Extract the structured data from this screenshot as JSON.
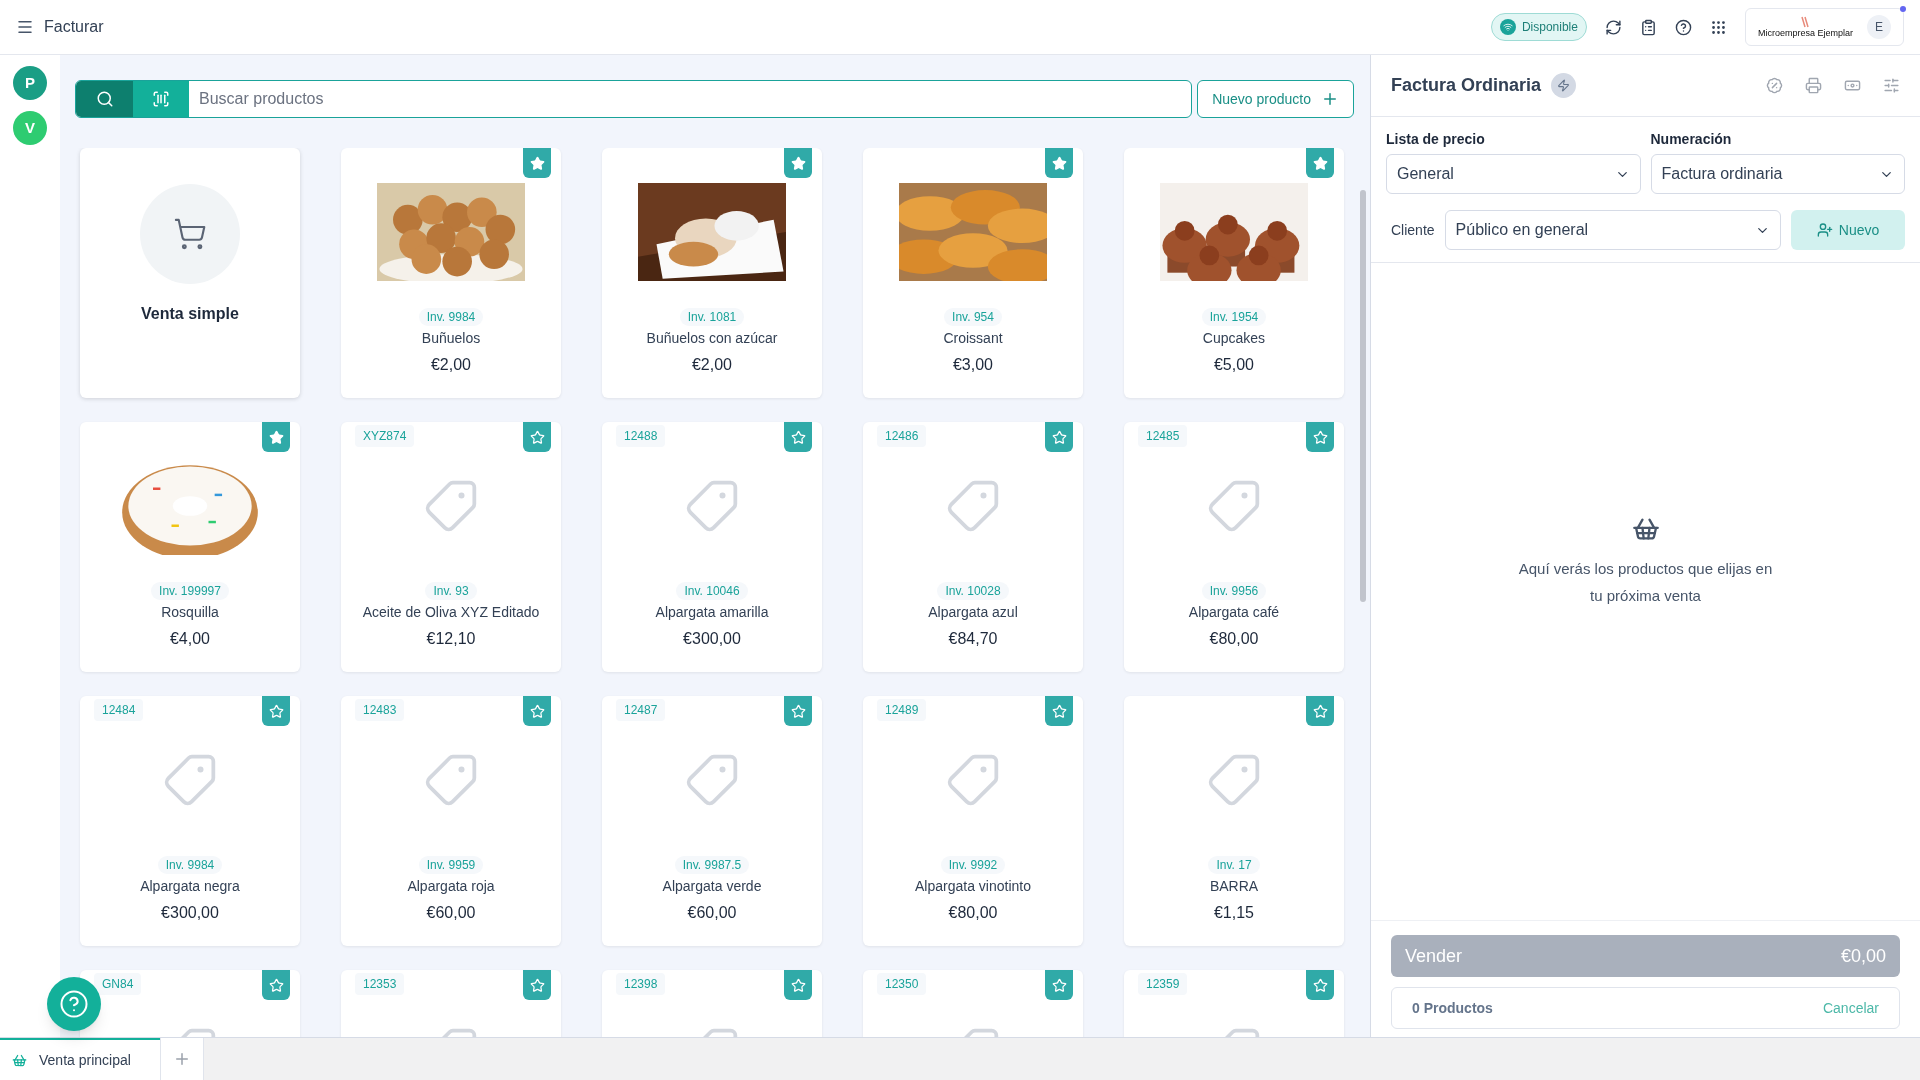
{
  "topbar": {
    "title": "Facturar",
    "status": "Disponible",
    "company": "Microempresa Ejemplar",
    "avatar": "E"
  },
  "sidebar": {
    "avatars": [
      {
        "letter": "P",
        "color": "#1a9e85"
      },
      {
        "letter": "V",
        "color": "#2ecc71"
      }
    ]
  },
  "search": {
    "placeholder": "Buscar productos",
    "new_button": "Nuevo producto"
  },
  "products": [
    {
      "kind": "simple",
      "name": "Venta simple"
    },
    {
      "kind": "product",
      "photo": true,
      "inv": "Inv. 9984",
      "name": "Buñuelos",
      "price": "€2,00",
      "favorite": true
    },
    {
      "kind": "product",
      "photo": true,
      "inv": "Inv. 1081",
      "name": "Buñuelos con azúcar",
      "price": "€2,00",
      "favorite": true
    },
    {
      "kind": "product",
      "photo": true,
      "inv": "Inv. 954",
      "name": "Croissant",
      "price": "€3,00",
      "favorite": true
    },
    {
      "kind": "product",
      "photo": true,
      "inv": "Inv. 1954",
      "name": "Cupcakes",
      "price": "€5,00",
      "favorite": true
    },
    {
      "kind": "product",
      "photo": true,
      "inv": "Inv. 199997",
      "name": "Rosquilla",
      "price": "€4,00",
      "favorite": true
    },
    {
      "kind": "product",
      "code": "XYZ874",
      "inv": "Inv. 93",
      "name": "Aceite de Oliva XYZ Editado",
      "price": "€12,10",
      "favorite": false
    },
    {
      "kind": "product",
      "code": "12488",
      "inv": "Inv. 10046",
      "name": "Alpargata amarilla",
      "price": "€300,00",
      "favorite": false
    },
    {
      "kind": "product",
      "code": "12486",
      "inv": "Inv. 10028",
      "name": "Alpargata azul",
      "price": "€84,70",
      "favorite": false
    },
    {
      "kind": "product",
      "code": "12485",
      "inv": "Inv. 9956",
      "name": "Alpargata café",
      "price": "€80,00",
      "favorite": false
    },
    {
      "kind": "product",
      "code": "12484",
      "inv": "Inv. 9984",
      "name": "Alpargata negra",
      "price": "€300,00",
      "favorite": false
    },
    {
      "kind": "product",
      "code": "12483",
      "inv": "Inv. 9959",
      "name": "Alpargata roja",
      "price": "€60,00",
      "favorite": false
    },
    {
      "kind": "product",
      "code": "12487",
      "inv": "Inv. 9987.5",
      "name": "Alpargata verde",
      "price": "€60,00",
      "favorite": false
    },
    {
      "kind": "product",
      "code": "12489",
      "inv": "Inv. 9992",
      "name": "Alpargata vinotinto",
      "price": "€80,00",
      "favorite": false
    },
    {
      "kind": "product",
      "inv": "Inv. 17",
      "name": "BARRA",
      "price": "€1,15",
      "favorite": false
    },
    {
      "kind": "product",
      "code": "GN84",
      "favorite": false
    },
    {
      "kind": "product",
      "code": "12353",
      "favorite": false
    },
    {
      "kind": "product",
      "code": "12398",
      "favorite": false
    },
    {
      "kind": "product",
      "code": "12350",
      "favorite": false
    },
    {
      "kind": "product",
      "code": "12359",
      "favorite": false
    }
  ],
  "invoice": {
    "title": "Factura Ordinaria",
    "price_list": {
      "label": "Lista de precio",
      "value": "General"
    },
    "numbering": {
      "label": "Numeración",
      "value": "Factura ordinaria"
    },
    "client": {
      "label": "Cliente",
      "value": "Público en general"
    },
    "new_client": "Nuevo",
    "empty_message": "Aquí verás los productos que elijas en tu próxima venta",
    "sell": {
      "label": "Vender",
      "total": "€0,00",
      "disabled": true
    },
    "count": "0 Productos",
    "cancel": "Cancelar"
  },
  "tabs": [
    {
      "label": "Venta principal",
      "selected": true
    }
  ]
}
